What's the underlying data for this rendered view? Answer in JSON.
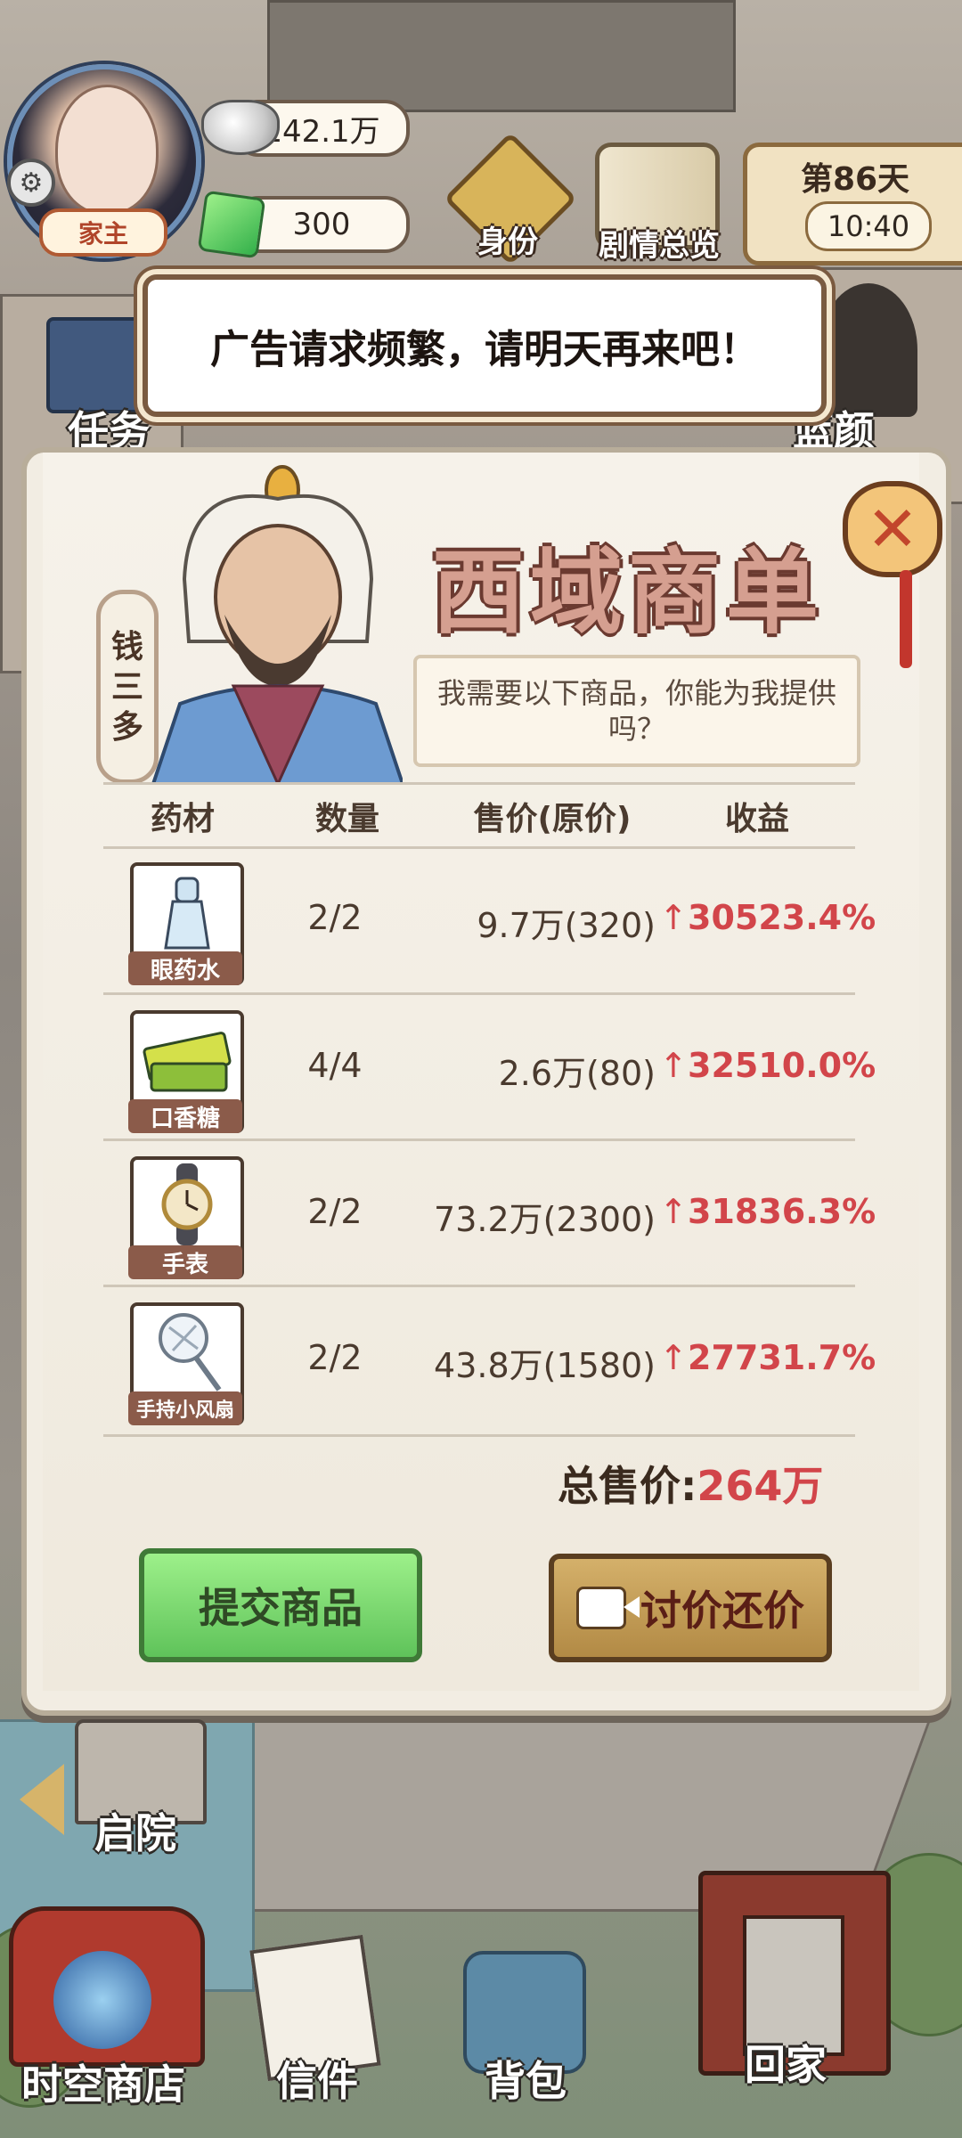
{
  "hud": {
    "role": "家主",
    "silver": "142.1万",
    "gems": "300",
    "identity_label": "身份",
    "story_label": "剧情总览",
    "day": "第86天",
    "time": "10:40"
  },
  "toast": "广告请求频繁，请明天再来吧！",
  "side": {
    "tasks": "任务",
    "lanyan": "蓝颜"
  },
  "panel": {
    "merchant_name": [
      "钱",
      "三",
      "多"
    ],
    "title": "西域商单",
    "speech": "我需要以下商品，你能为我提供吗？",
    "headers": {
      "item": "药材",
      "qty": "数量",
      "price": "售价(原价)",
      "profit": "收益"
    },
    "rows": [
      {
        "name": "眼药水",
        "qty": "2/2",
        "price": "9.7万(320)",
        "arrow": "↑",
        "profit": "30523.4%"
      },
      {
        "name": "口香糖",
        "qty": "4/4",
        "price": "2.6万(80)",
        "arrow": "↑",
        "profit": "32510.0%"
      },
      {
        "name": "手表",
        "qty": "2/2",
        "price": "73.2万(2300)",
        "arrow": "↑",
        "profit": "31836.3%"
      },
      {
        "name": "手持小风扇",
        "qty": "2/2",
        "price": "43.8万(1580)",
        "arrow": "↑",
        "profit": "27731.7%"
      }
    ],
    "total_label": "总售价:",
    "total_value": "264万",
    "submit": "提交商品",
    "bargain": "讨价还价",
    "close": "✕"
  },
  "nav": {
    "backyard": "启院",
    "shop": "时空商店",
    "letters": "信件",
    "bag": "背包",
    "home": "回家"
  }
}
